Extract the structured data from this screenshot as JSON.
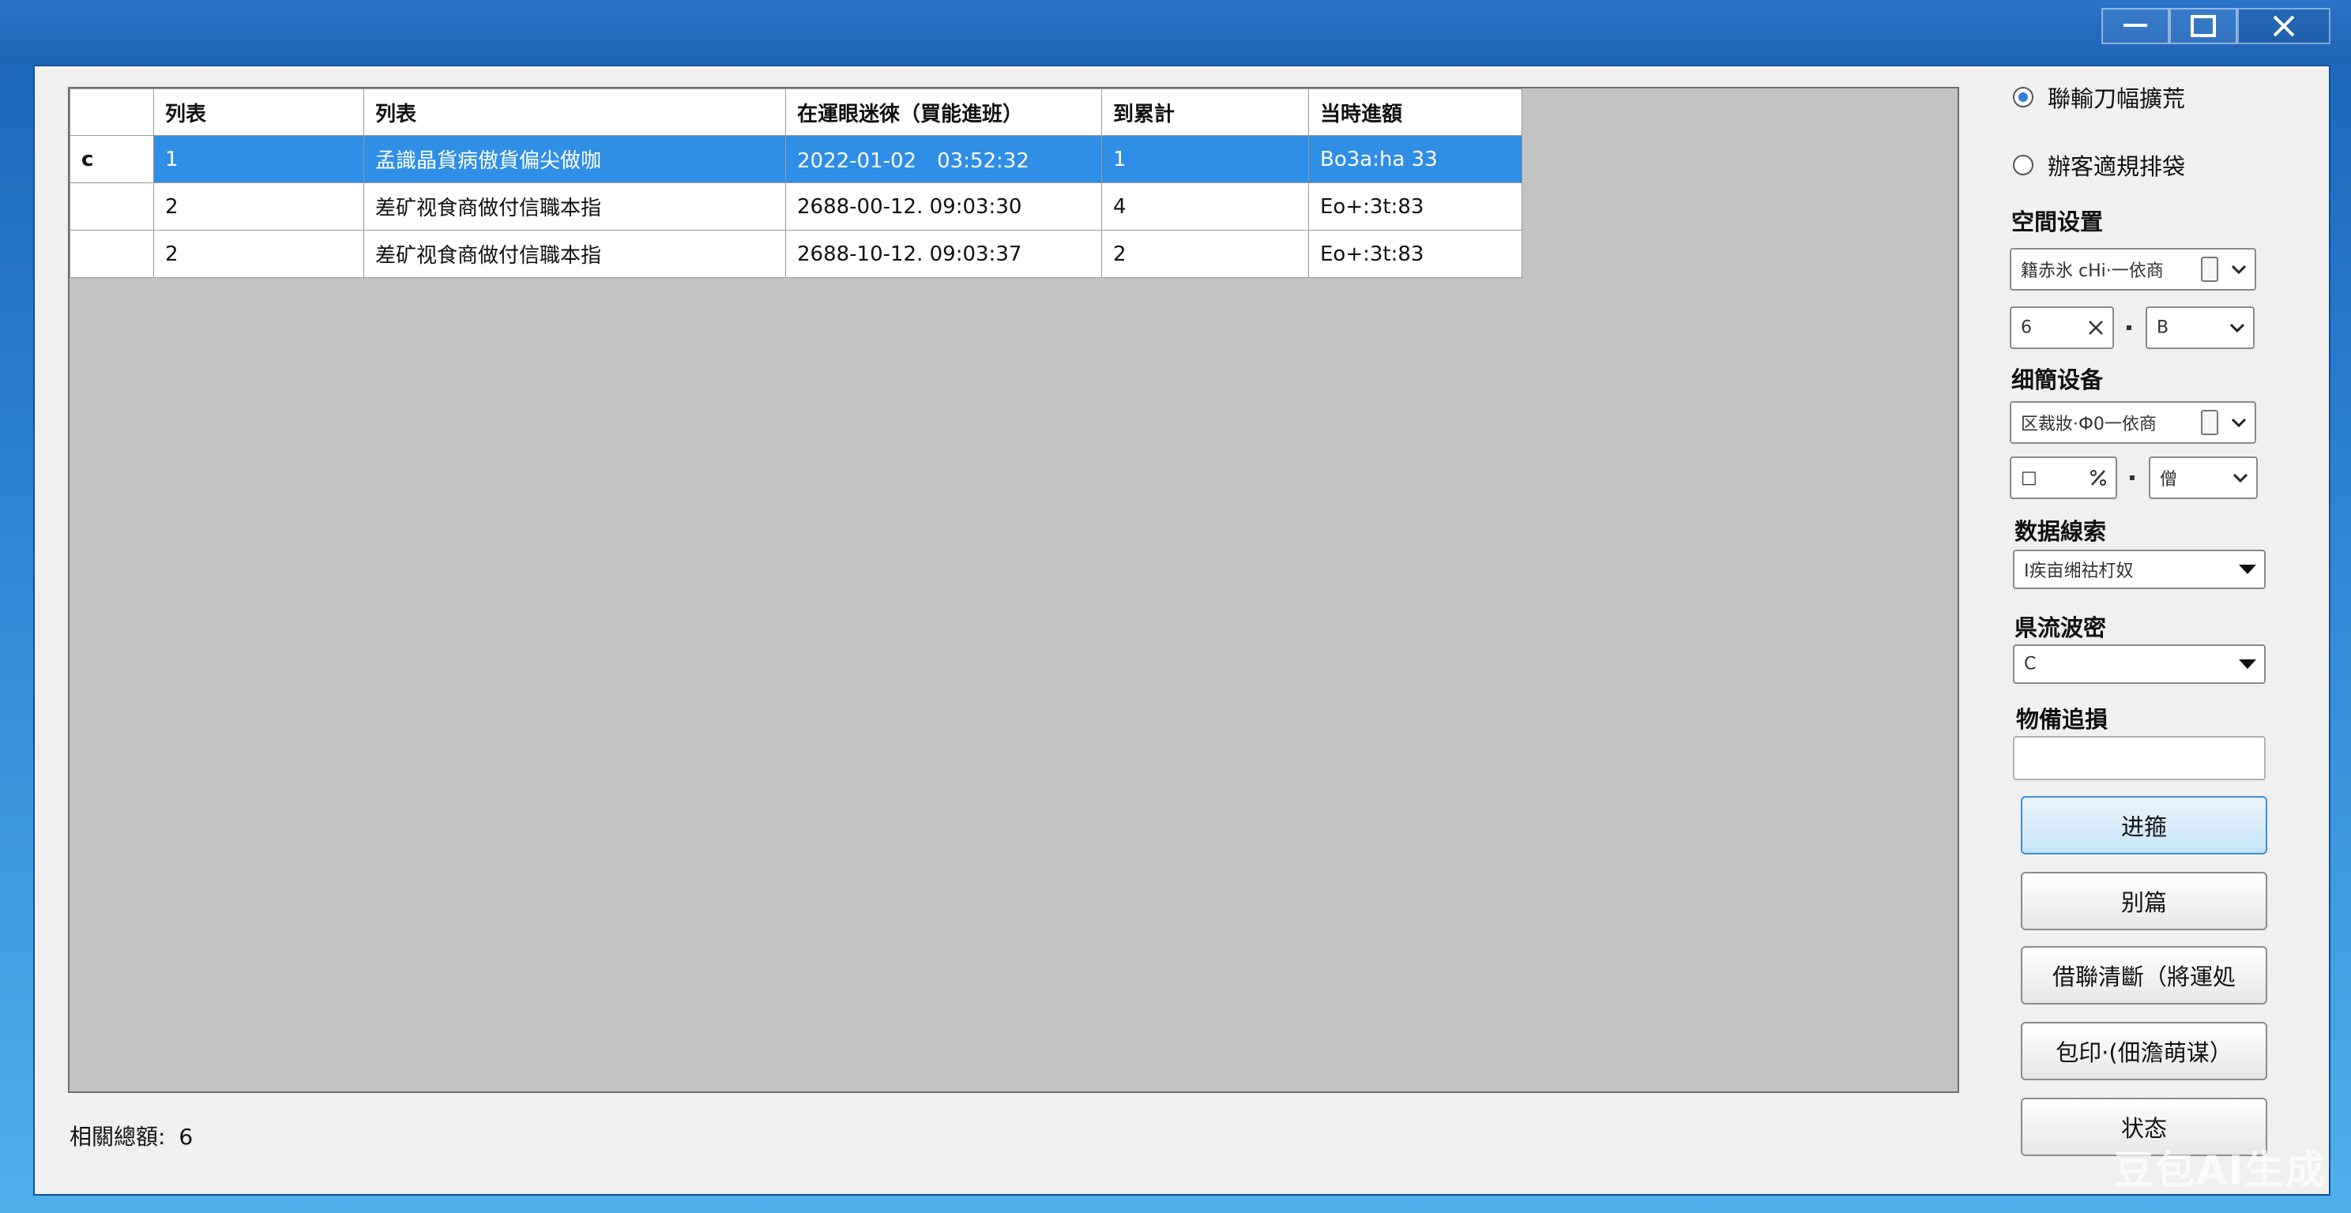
{
  "window": {
    "controls": [
      "minimize-icon",
      "maximize-icon",
      "close-icon"
    ]
  },
  "grid": {
    "columns": [
      "",
      "列表",
      "列表",
      "在運眼迷徠（買能進班）",
      "到累計",
      "当時進額"
    ],
    "rows": [
      [
        "c",
        "1",
        "孟識晶貨病傲貨偏尖做咖",
        "2022-01-02　03:52:32",
        "1",
        "Bo3a:ha 33"
      ],
      [
        "",
        "2",
        "差矿视食商做付信職本指",
        "2688-00-12. 09:03:30",
        "4",
        "Eo+:3t:83"
      ],
      [
        "",
        "2",
        "差矿视食商做付信職本指",
        "2688-10-12. 09:03:37",
        "2",
        "Eo+:3t:83"
      ]
    ],
    "selected_row": 0
  },
  "status": {
    "label": "相關總額:",
    "value": "6"
  },
  "right_panel": {
    "radio1": "聯輸刀幅擴荒",
    "radio2": "辦客適規排袋",
    "space_label": "空間设置",
    "space_select": "籍赤氷 cHi·一依商",
    "space_spin_left": "6",
    "space_spin_right": "B",
    "detail_label": "细簡设备",
    "detail_select": "区裁妝·Ф0一依商",
    "detail_spin_left": "□",
    "detail_spin_right": "僧",
    "data_label": "数据線索",
    "data_select": "I疾亩缃祜朾奴",
    "flow_label": "県流波密",
    "flow_select": "C",
    "track_label": "物備追損",
    "track_value": "",
    "buttons": {
      "go": "进箍",
      "other": "别篇",
      "clear": "借聯清斷（將運処",
      "print": "包印·(佃澹萌谋）",
      "state": "状态"
    }
  },
  "watermark": "豆包AI生成",
  "colors": {
    "selected_row": "#2f8ee6",
    "title_bar": "#1f63b5",
    "grid_background": "#c3c3c3"
  }
}
